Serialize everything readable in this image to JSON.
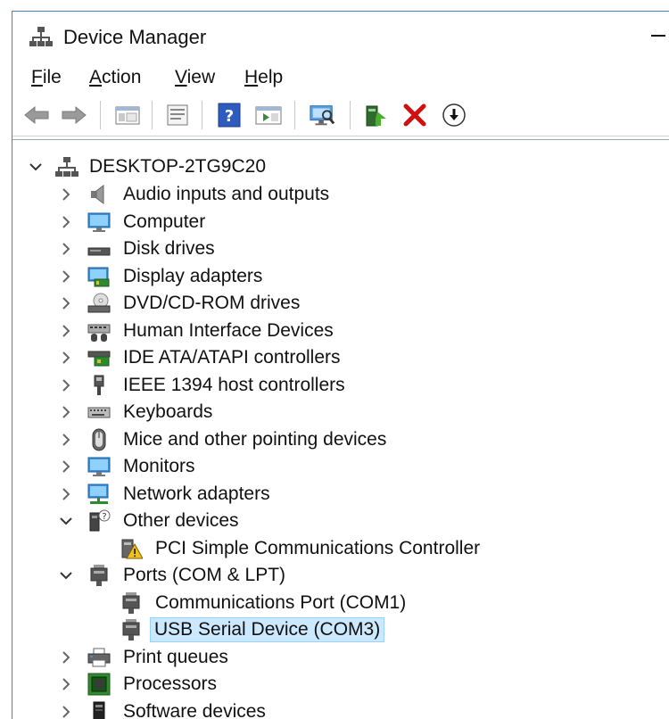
{
  "window": {
    "title": "Device Manager"
  },
  "menu": [
    {
      "id": "file",
      "underline": "F",
      "rest": "ile"
    },
    {
      "id": "action",
      "underline": "A",
      "rest": "ction"
    },
    {
      "id": "view",
      "underline": "V",
      "rest": "iew"
    },
    {
      "id": "help",
      "underline": "H",
      "rest": "elp"
    }
  ],
  "toolbar": {
    "icons": [
      "back-arrow-icon",
      "forward-arrow-icon",
      "show-hide-console-tree-icon",
      "properties-icon",
      "help-icon",
      "run-action-icon",
      "scan-hardware-changes-icon",
      "update-driver-icon",
      "uninstall-device-icon",
      "disable-device-icon"
    ]
  },
  "colors": {
    "accent": "#4a7ec4",
    "selection": "#cce8ff",
    "uninstall_red": "#d01010"
  },
  "tree": {
    "root": "DESKTOP-2TG9C20",
    "categories": [
      {
        "label": "Audio inputs and outputs",
        "icon": "speaker-icon",
        "expanded": false
      },
      {
        "label": "Computer",
        "icon": "computer-icon",
        "expanded": false
      },
      {
        "label": "Disk drives",
        "icon": "disk-drive-icon",
        "expanded": false
      },
      {
        "label": "Display adapters",
        "icon": "display-adapter-icon",
        "expanded": false
      },
      {
        "label": "DVD/CD-ROM drives",
        "icon": "dvd-drive-icon",
        "expanded": false
      },
      {
        "label": "Human Interface Devices",
        "icon": "hid-icon",
        "expanded": false
      },
      {
        "label": "IDE ATA/ATAPI controllers",
        "icon": "ide-controller-icon",
        "expanded": false
      },
      {
        "label": "IEEE 1394 host controllers",
        "icon": "ieee1394-icon",
        "expanded": false
      },
      {
        "label": "Keyboards",
        "icon": "keyboard-icon",
        "expanded": false
      },
      {
        "label": "Mice and other pointing devices",
        "icon": "mouse-icon",
        "expanded": false
      },
      {
        "label": "Monitors",
        "icon": "monitor-icon",
        "expanded": false
      },
      {
        "label": "Network adapters",
        "icon": "network-adapter-icon",
        "expanded": false
      },
      {
        "label": "Other devices",
        "icon": "unknown-device-icon",
        "expanded": true,
        "children": [
          {
            "label": "PCI Simple Communications Controller",
            "icon": "warning-device-icon",
            "selected": false
          }
        ]
      },
      {
        "label": "Ports (COM & LPT)",
        "icon": "port-icon",
        "expanded": true,
        "children": [
          {
            "label": "Communications Port (COM1)",
            "icon": "port-icon",
            "selected": false
          },
          {
            "label": "USB Serial Device (COM3)",
            "icon": "port-icon",
            "selected": true
          }
        ]
      },
      {
        "label": "Print queues",
        "icon": "printer-icon",
        "expanded": false
      },
      {
        "label": "Processors",
        "icon": "processor-icon",
        "expanded": false
      },
      {
        "label": "Software devices",
        "icon": "software-device-icon",
        "expanded": false
      }
    ]
  }
}
